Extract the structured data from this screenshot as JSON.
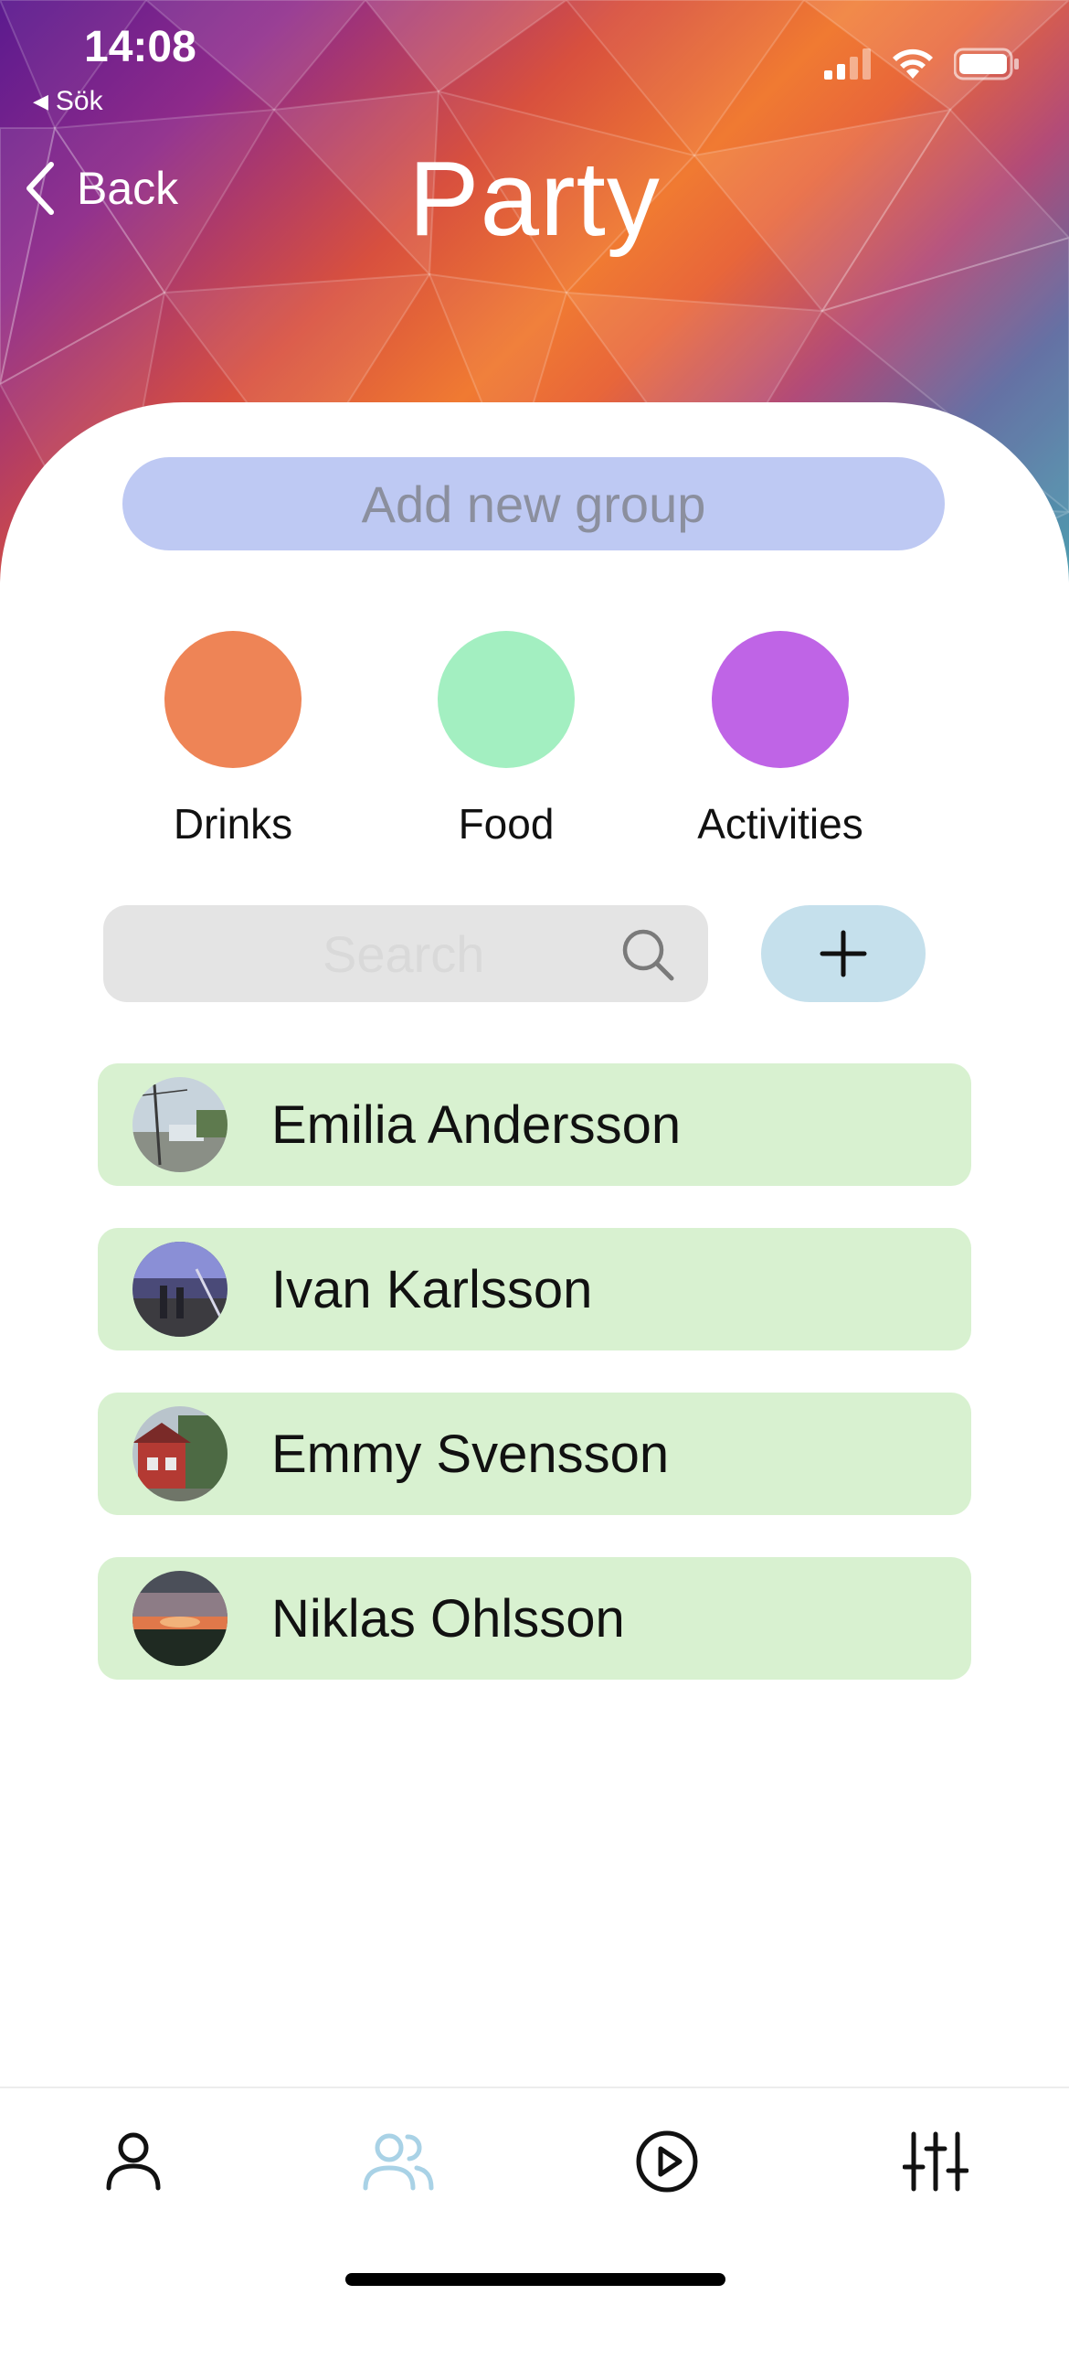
{
  "status_bar": {
    "time": "14:08",
    "back_app_label": "Sök",
    "icons": [
      "cellular-signal-icon",
      "wifi-icon",
      "battery-icon"
    ]
  },
  "nav": {
    "back_label": "Back",
    "title": "Party"
  },
  "add_group": {
    "label": "Add new group"
  },
  "categories": [
    {
      "label": "Drinks",
      "color": "#ee8456"
    },
    {
      "label": "Food",
      "color": "#a3efc1"
    },
    {
      "label": "Activities",
      "color": "#bf64e6"
    }
  ],
  "search": {
    "placeholder": "Search",
    "value": ""
  },
  "members": [
    {
      "name": "Emilia Andersson",
      "avatar": "street-photo"
    },
    {
      "name": "Ivan Karlsson",
      "avatar": "station-photo"
    },
    {
      "name": "Emmy Svensson",
      "avatar": "red-house-photo"
    },
    {
      "name": "Niklas Ohlsson",
      "avatar": "sunset-photo"
    }
  ],
  "tab_bar": {
    "items": [
      {
        "icon": "person-icon",
        "active": false
      },
      {
        "icon": "group-icon",
        "active": true
      },
      {
        "icon": "play-circle-icon",
        "active": false
      },
      {
        "icon": "sliders-icon",
        "active": false
      }
    ],
    "active_color": "#a9d2e6"
  }
}
